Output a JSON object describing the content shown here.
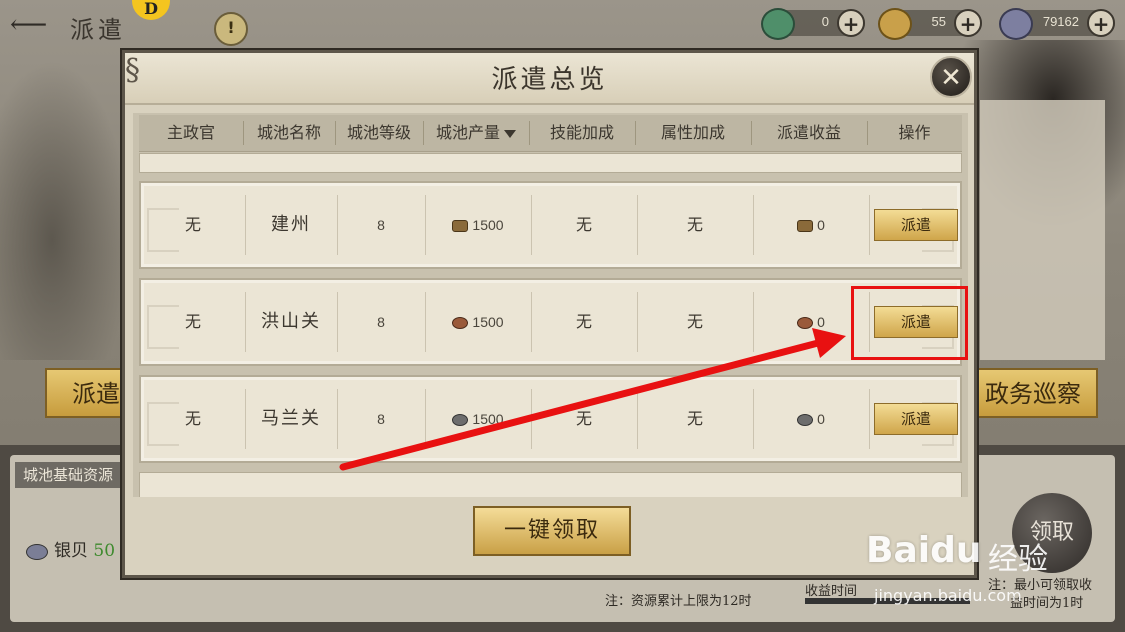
{
  "topbar": {
    "title": "派遣",
    "badge": "D",
    "alert": "!",
    "resources": [
      {
        "name": "jade",
        "value": "0",
        "color": "#4f8f6a"
      },
      {
        "name": "gold",
        "value": "55",
        "color": "#c9a04a"
      },
      {
        "name": "silver",
        "value": "79162",
        "color": "#7d7fa0"
      }
    ]
  },
  "background": {
    "left_button": "派遣",
    "right_button": "政务巡察",
    "base_label": "城池基础资源",
    "silver_label": "银贝",
    "silver_value": "50",
    "collect_button": "领取",
    "note_right_1": "注：最小可领取收",
    "note_right_2": "益时间为1时",
    "income_label": "收益时间"
  },
  "modal": {
    "title": "派遣总览",
    "close": "✕",
    "columns": [
      "主政官",
      "城池名称",
      "城池等级",
      "城池产量",
      "技能加成",
      "属性加成",
      "派遣收益",
      "操作"
    ],
    "rows": [
      {
        "governor": "无",
        "city": "建州",
        "level": "8",
        "output": "1500",
        "res_icon": "wood-icon",
        "skill": "无",
        "attr": "无",
        "income": "0",
        "action": "派遣"
      },
      {
        "governor": "无",
        "city": "洪山关",
        "level": "8",
        "output": "1500",
        "res_icon": "iron-ore-icon",
        "skill": "无",
        "attr": "无",
        "income": "0",
        "action": "派遣"
      },
      {
        "governor": "无",
        "city": "马兰关",
        "level": "8",
        "output": "1500",
        "res_icon": "stone-icon",
        "skill": "无",
        "attr": "无",
        "income": "0",
        "action": "派遣"
      }
    ],
    "collect_all": "一键领取",
    "note": "注：资源累计上限为12时"
  },
  "watermark": {
    "brand": "Baidu",
    "suffix": "经验",
    "url": "jingyan.baidu.com"
  },
  "colors": {
    "highlight": "#e81111",
    "gold_button": "#e0bf6a"
  }
}
